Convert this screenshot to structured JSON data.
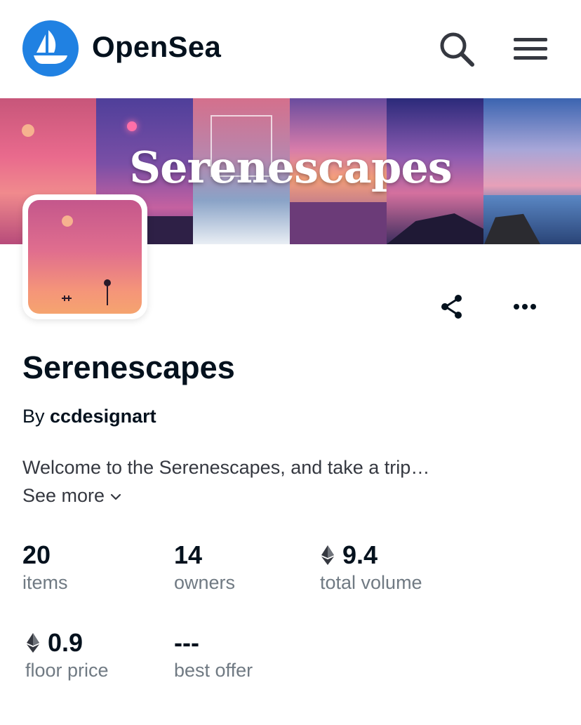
{
  "header": {
    "brand": "OpenSea",
    "icons": {
      "logo": "opensea-boat-logo-icon",
      "search": "search-icon",
      "menu": "hamburger-menu-icon"
    },
    "colors": {
      "logo_bg": "#2081e2",
      "text": "#04111d"
    }
  },
  "banner": {
    "title": "Serenescapes"
  },
  "actions": {
    "share": "share-icon",
    "more": "more-options-icon"
  },
  "collection": {
    "title": "Serenescapes",
    "by_prefix": "By",
    "creator": "ccdesignart",
    "description": "Welcome to the Serenescapes, and take a trip…",
    "see_more": "See more"
  },
  "stats": [
    {
      "value": "20",
      "label": "items",
      "currency_icon": null
    },
    {
      "value": "14",
      "label": "owners",
      "currency_icon": null
    },
    {
      "value": "9.4",
      "label": "total volume",
      "currency_icon": "ethereum-icon"
    },
    {
      "value": "0.9",
      "label": "floor price",
      "currency_icon": "ethereum-icon"
    },
    {
      "value": "---",
      "label": "best offer",
      "currency_icon": null
    }
  ]
}
